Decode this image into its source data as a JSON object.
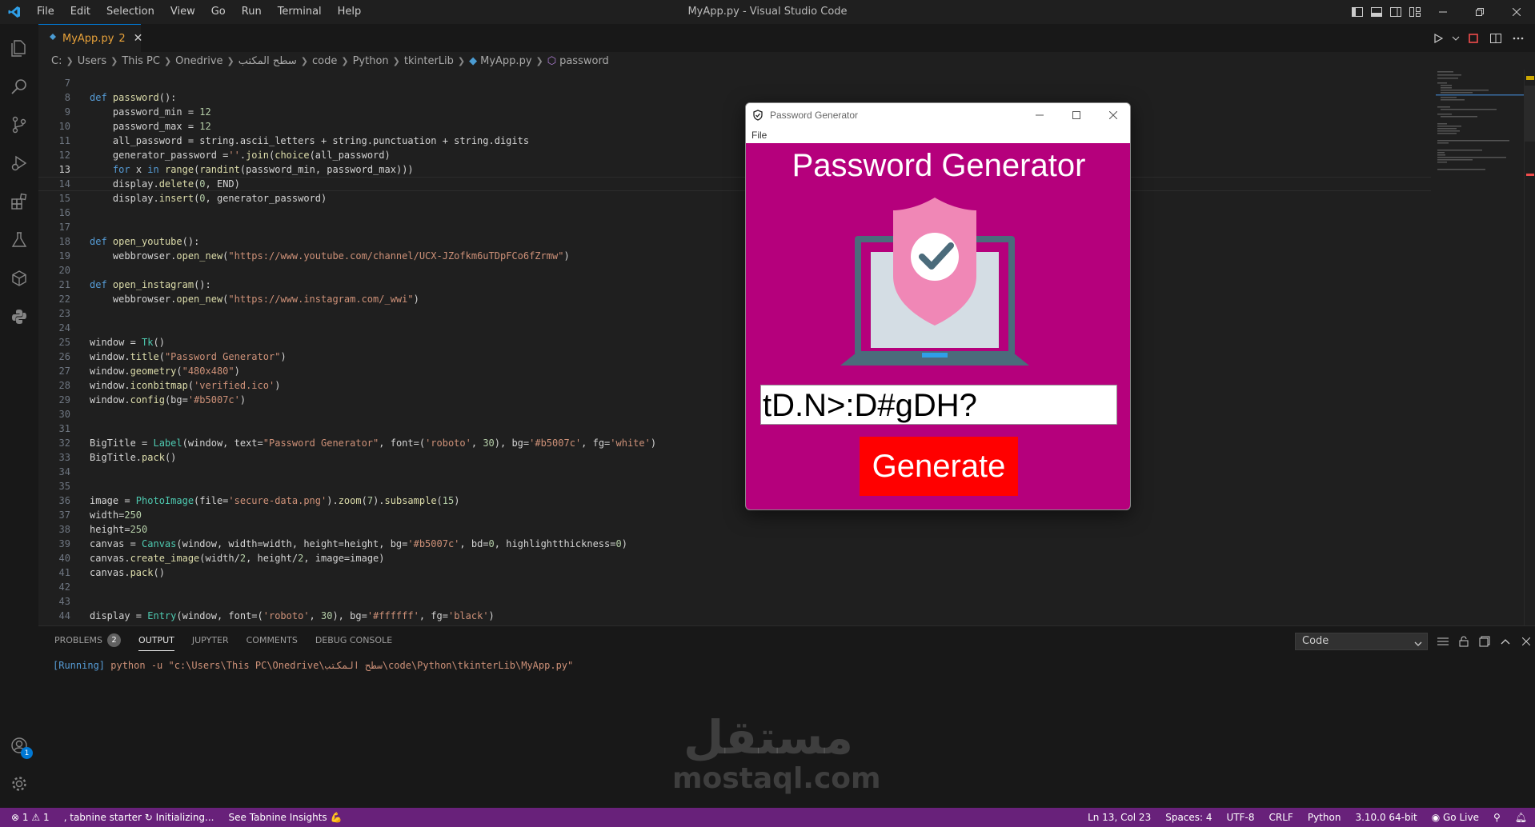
{
  "titlebar": {
    "menu": [
      "File",
      "Edit",
      "Selection",
      "View",
      "Go",
      "Run",
      "Terminal",
      "Help"
    ],
    "window_title": "MyApp.py - Visual Studio Code"
  },
  "tab": {
    "name": "MyApp.py",
    "problems": "2"
  },
  "breadcrumb": [
    "C:",
    "Users",
    "This PC",
    "Onedrive",
    "سطح المكتب",
    "code",
    "Python",
    "tkinterLib",
    "MyApp.py",
    "password"
  ],
  "editor": {
    "current_line": 13,
    "lines": [
      {
        "n": "7",
        "t": ""
      },
      {
        "n": "8",
        "t": "def password():"
      },
      {
        "n": "9",
        "t": "    password_min = 12"
      },
      {
        "n": "10",
        "t": "    password_max = 12"
      },
      {
        "n": "11",
        "t": "    all_password = string.ascii_letters + string.punctuation + string.digits"
      },
      {
        "n": "12",
        "t": "    generator_password =''.join(choice(all_password)"
      },
      {
        "n": "13",
        "t": "    for x in range(randint(password_min, password_max)))"
      },
      {
        "n": "14",
        "t": "    display.delete(0, END)"
      },
      {
        "n": "15",
        "t": "    display.insert(0, generator_password)"
      },
      {
        "n": "16",
        "t": ""
      },
      {
        "n": "17",
        "t": ""
      },
      {
        "n": "18",
        "t": "def open_youtube():"
      },
      {
        "n": "19",
        "t": "    webbrowser.open_new(\"https://www.youtube.com/channel/UCX-JZofkm6uTDpFCo6fZrmw\")"
      },
      {
        "n": "20",
        "t": ""
      },
      {
        "n": "21",
        "t": "def open_instagram():"
      },
      {
        "n": "22",
        "t": "    webbrowser.open_new(\"https://www.instagram.com/_wwi\")"
      },
      {
        "n": "23",
        "t": ""
      },
      {
        "n": "24",
        "t": ""
      },
      {
        "n": "25",
        "t": "window = Tk()"
      },
      {
        "n": "26",
        "t": "window.title(\"Password Generator\")"
      },
      {
        "n": "27",
        "t": "window.geometry(\"480x480\")"
      },
      {
        "n": "28",
        "t": "window.iconbitmap('verified.ico')"
      },
      {
        "n": "29",
        "t": "window.config(bg='#b5007c')"
      },
      {
        "n": "30",
        "t": ""
      },
      {
        "n": "31",
        "t": ""
      },
      {
        "n": "32",
        "t": "BigTitle = Label(window, text=\"Password Generator\", font=('roboto', 30), bg='#b5007c', fg='white')"
      },
      {
        "n": "33",
        "t": "BigTitle.pack()"
      },
      {
        "n": "34",
        "t": ""
      },
      {
        "n": "35",
        "t": ""
      },
      {
        "n": "36",
        "t": "image = PhotoImage(file='secure-data.png').zoom(7).subsample(15)"
      },
      {
        "n": "37",
        "t": "width=250"
      },
      {
        "n": "38",
        "t": "height=250"
      },
      {
        "n": "39",
        "t": "canvas = Canvas(window, width=width, height=height, bg='#b5007c', bd=0, highlightthickness=0)"
      },
      {
        "n": "40",
        "t": "canvas.create_image(width/2, height/2, image=image)"
      },
      {
        "n": "41",
        "t": "canvas.pack()"
      },
      {
        "n": "42",
        "t": ""
      },
      {
        "n": "43",
        "t": ""
      },
      {
        "n": "44",
        "t": "display = Entry(window, font=('roboto', 30), bg='#ffffff', fg='black')"
      }
    ]
  },
  "panel": {
    "tabs": [
      "PROBLEMS",
      "OUTPUT",
      "JUPYTER",
      "COMMENTS",
      "DEBUG CONSOLE"
    ],
    "problems_count": "2",
    "select_value": "Code",
    "output_prefix": "[Running]",
    "output_text": " python -u \"c:\\Users\\This PC\\Onedrive\\سطح المكتب\\code\\Python\\tkinterLib\\MyApp.py\""
  },
  "watermark": {
    "arabic": "مستقل",
    "latin": "mostaql.com"
  },
  "statusbar": {
    "errors": "1",
    "warnings": "1",
    "tabnine": "tabnine starter",
    "initializing": "Initializing...",
    "insights": "See Tabnine Insights 💪",
    "position": "Ln 13, Col 23",
    "spaces": "Spaces: 4",
    "encoding": "UTF-8",
    "eol": "CRLF",
    "language": "Python",
    "interpreter": "3.10.0 64-bit",
    "golive": "Go Live"
  },
  "accounts_badge": "1",
  "tkwindow": {
    "title": "Password Generator",
    "menu": "File",
    "big_title": "Password Generator",
    "entry_value": "tD.N>:D#gDH?",
    "button_label": "Generate"
  },
  "colors": {
    "accent": "#0078d4",
    "statusbar": "#68217a",
    "tk_bg": "#b5007c",
    "tk_button": "#ff0000",
    "keyword": "#569cd6",
    "function": "#dcdcaa",
    "string": "#ce9178",
    "number": "#b5cea8"
  },
  "icons": {
    "activity": [
      "explorer-icon",
      "search-icon",
      "source-control-icon",
      "run-debug-icon",
      "extensions-icon",
      "testing-icon",
      "remote-icon",
      "python-icon"
    ]
  }
}
